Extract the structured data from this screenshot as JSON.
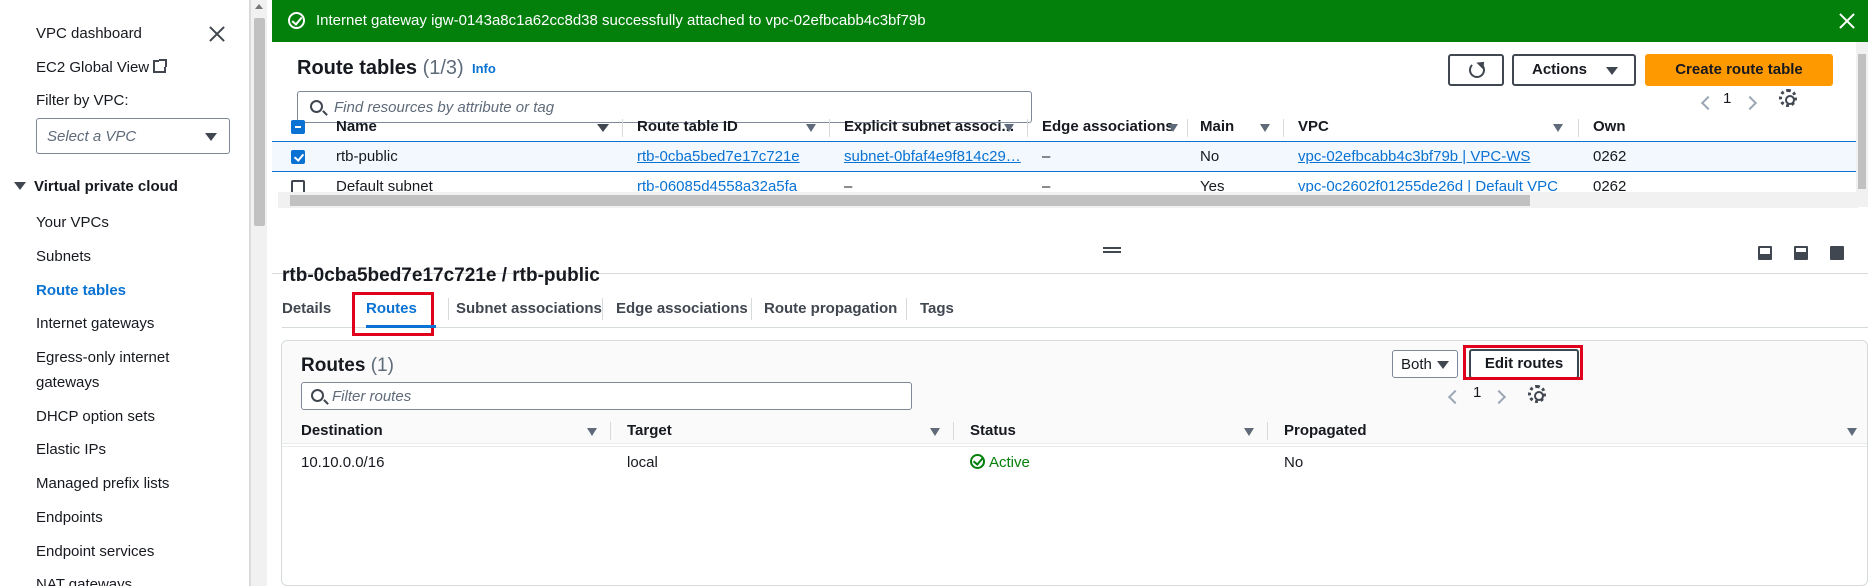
{
  "sidebar": {
    "dashboard": "VPC dashboard",
    "global_view": "EC2 Global View",
    "filter_label": "Filter by VPC:",
    "filter_placeholder": "Select a VPC",
    "section": "Virtual private cloud",
    "items": [
      {
        "label": "Your VPCs"
      },
      {
        "label": "Subnets"
      },
      {
        "label": "Route tables"
      },
      {
        "label": "Internet gateways"
      },
      {
        "label": "Egress-only internet"
      },
      {
        "label": "gateways"
      },
      {
        "label": "DHCP option sets"
      },
      {
        "label": "Elastic IPs"
      },
      {
        "label": "Managed prefix lists"
      },
      {
        "label": "Endpoints"
      },
      {
        "label": "Endpoint services"
      },
      {
        "label": "NAT gateways"
      }
    ],
    "active_item": "Route tables"
  },
  "flash": {
    "message": "Internet gateway igw-0143a8c1a62cc8d38 successfully attached to vpc-02efbcabb4c3bf79b",
    "color": "#037f0c"
  },
  "route_tables": {
    "title": "Route tables",
    "count": "(1/3)",
    "info": "Info",
    "actions_label": "Actions",
    "create_label": "Create route table",
    "search_placeholder": "Find resources by attribute or tag",
    "page": "1",
    "columns": [
      "Name",
      "Route table ID",
      "Explicit subnet associ...",
      "Edge associations",
      "Main",
      "VPC",
      "Own"
    ],
    "rows": [
      {
        "name": "rtb-public",
        "id": "rtb-0cba5bed7e17c721e",
        "subnet": "subnet-0bfaf4e9f814c29…",
        "edge": "–",
        "main": "No",
        "vpc": "vpc-02efbcabb4c3bf79b | VPC-WS",
        "owner": "0262",
        "selected": true
      },
      {
        "name": "Default subnet",
        "id": "rtb-06085d4558a32a5fa",
        "subnet": "–",
        "edge": "–",
        "main": "Yes",
        "vpc": "vpc-0c2602f01255de26d | Default VPC",
        "owner": "0262",
        "selected": false
      }
    ]
  },
  "detail": {
    "title": "rtb-0cba5bed7e17c721e / rtb-public",
    "tabs": [
      "Details",
      "Routes",
      "Subnet associations",
      "Edge associations",
      "Route propagation",
      "Tags"
    ],
    "active_tab": "Routes"
  },
  "routes": {
    "title": "Routes",
    "count": "(1)",
    "filter_value": "Both",
    "edit_label": "Edit routes",
    "search_placeholder": "Filter routes",
    "page": "1",
    "columns": [
      "Destination",
      "Target",
      "Status",
      "Propagated"
    ],
    "rows": [
      {
        "destination": "10.10.0.0/16",
        "target": "local",
        "status": "Active",
        "propagated": "No"
      }
    ]
  },
  "colors": {
    "accent": "#0972d3",
    "primary_button": "#ff9900",
    "success": "#037f0c",
    "highlight": "#e0001b"
  }
}
